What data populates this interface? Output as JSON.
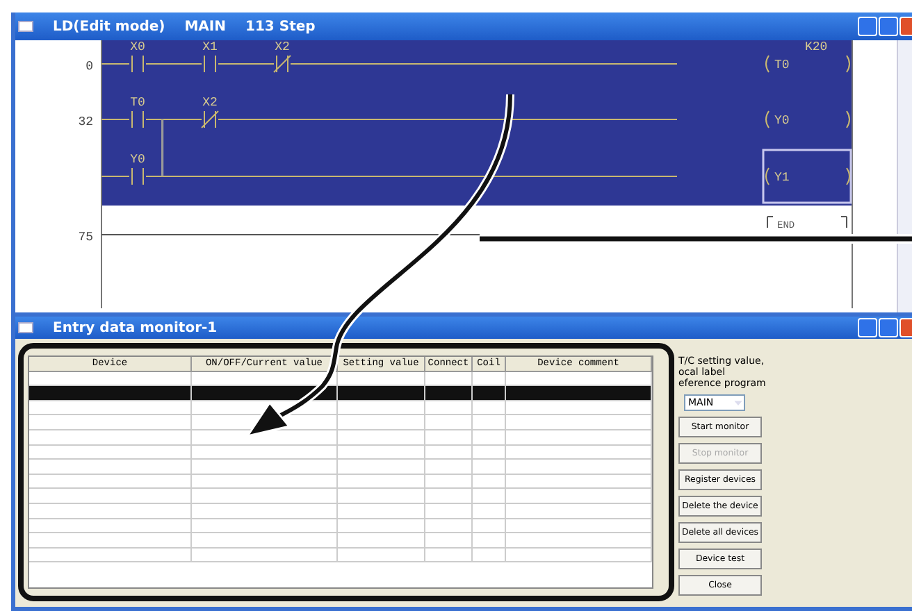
{
  "ladder_window": {
    "title": "LD(Edit mode)",
    "program": "MAIN",
    "steps": "113 Step",
    "rows": [
      {
        "step": "0",
        "highlighted": true,
        "contacts": [
          {
            "label": "X0",
            "kind": "no"
          },
          {
            "label": "X1",
            "kind": "no"
          },
          {
            "label": "X2",
            "kind": "nc"
          }
        ],
        "coil": {
          "kind": "out",
          "label": "T0",
          "setting": "K20"
        }
      },
      {
        "step": "32",
        "highlighted": true,
        "contacts": [
          {
            "label": "T0",
            "kind": "no"
          },
          {
            "label": "X2",
            "kind": "nc"
          }
        ],
        "coil": {
          "kind": "out",
          "label": "Y0"
        }
      },
      {
        "highlighted": true,
        "branch": true,
        "contacts": [
          {
            "label": "Y0",
            "kind": "no"
          }
        ],
        "coil": {
          "kind": "out",
          "label": "Y1",
          "selected": true
        }
      },
      {
        "step": "75",
        "contacts": [],
        "coil": {
          "kind": "end",
          "label": "END"
        }
      }
    ]
  },
  "monitor_window": {
    "title": "Entry data monitor-1",
    "table": {
      "columns": [
        "Device",
        "ON/OFF/Current value",
        "Setting value",
        "Connect",
        "Coil",
        "Device comment"
      ],
      "rows": [
        {
          "selected": false
        },
        {
          "selected": true
        },
        {
          "selected": false
        },
        {
          "selected": false
        },
        {
          "selected": false
        },
        {
          "selected": false
        },
        {
          "selected": false
        },
        {
          "selected": false
        },
        {
          "selected": false
        },
        {
          "selected": false
        },
        {
          "selected": false
        },
        {
          "selected": false
        },
        {
          "selected": false
        }
      ]
    },
    "side_label": [
      "T/C setting value,",
      "ocal label",
      "eference program"
    ],
    "program_select": {
      "value": "MAIN"
    },
    "buttons": [
      {
        "label": "Start monitor",
        "disabled": false
      },
      {
        "label": "Stop monitor",
        "disabled": true
      },
      {
        "label": "Register devices",
        "disabled": false
      },
      {
        "label": "Delete the device",
        "disabled": false
      },
      {
        "label": "Delete all devices",
        "disabled": false
      },
      {
        "label": "Device test",
        "disabled": false
      },
      {
        "label": "Close",
        "disabled": false
      }
    ]
  }
}
